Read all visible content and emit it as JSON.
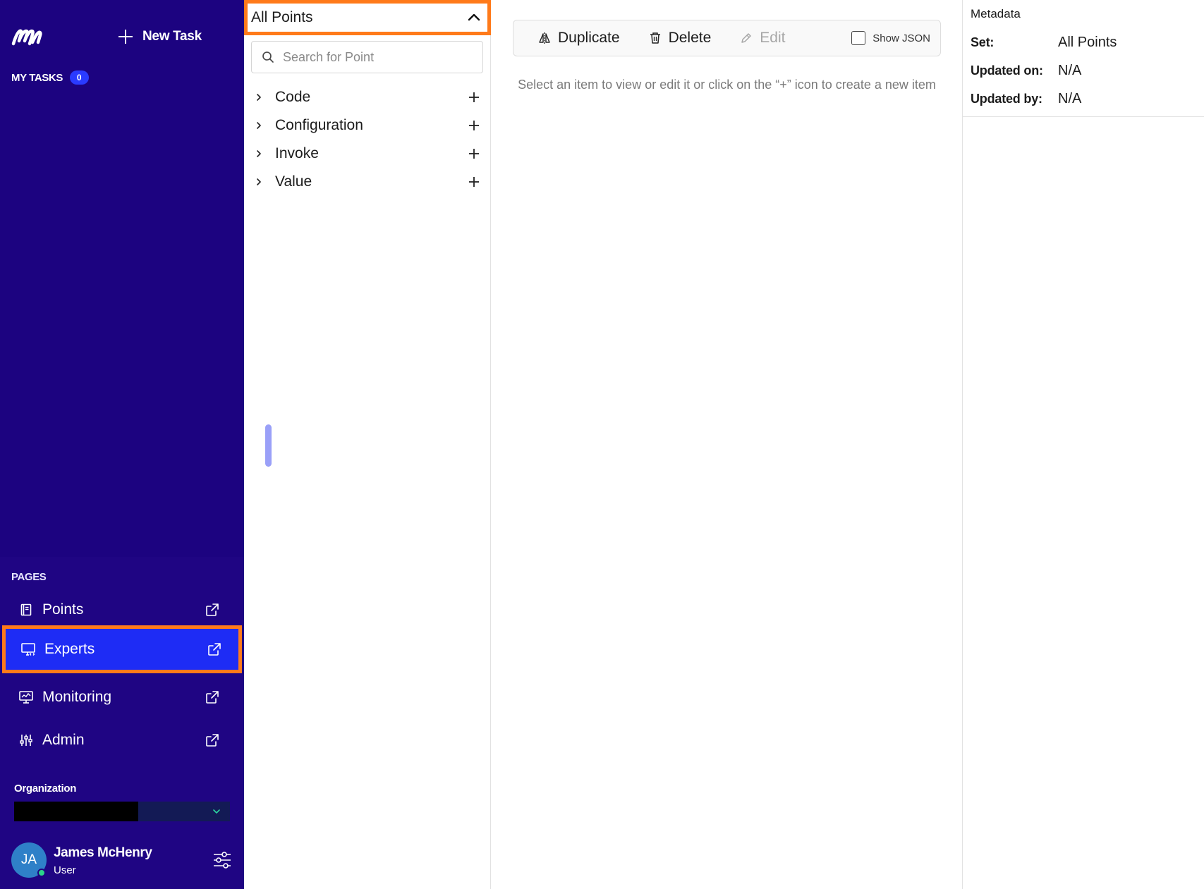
{
  "sidebar": {
    "new_task_label": "New Task",
    "my_tasks_label": "MY TASKS",
    "my_tasks_count": "0",
    "pages_title": "PAGES",
    "pages": [
      {
        "label": "Points",
        "icon": "book-icon"
      },
      {
        "label": "Experts",
        "icon": "monitor-code-icon"
      },
      {
        "label": "Monitoring",
        "icon": "monitor-chart-icon"
      },
      {
        "label": "Admin",
        "icon": "sliders-icon"
      }
    ],
    "organization_label": "Organization",
    "user": {
      "initials": "JA",
      "name": "James McHenry",
      "role": "User"
    }
  },
  "tree": {
    "set_selected": "All Points",
    "search_placeholder": "Search for Point",
    "items": [
      {
        "label": "Code"
      },
      {
        "label": "Configuration"
      },
      {
        "label": "Invoke"
      },
      {
        "label": "Value"
      }
    ]
  },
  "toolbar": {
    "duplicate_label": "Duplicate",
    "delete_label": "Delete",
    "edit_label": "Edit",
    "show_json_label": "Show JSON"
  },
  "main": {
    "empty_message": "Select an item to view or edit it or click on the “+” icon to create a new item"
  },
  "metadata": {
    "title": "Metadata",
    "set_key": "Set:",
    "set_value": "All Points",
    "updated_on_key": "Updated on:",
    "updated_on_value": "N/A",
    "updated_by_key": "Updated by:",
    "updated_by_value": "N/A"
  },
  "colors": {
    "sidebar_bg": "#1c0380",
    "active_nav": "#1e2cf5",
    "highlight_border": "#ff7a1a",
    "badge": "#2a3bff",
    "online": "#2bd48a"
  }
}
